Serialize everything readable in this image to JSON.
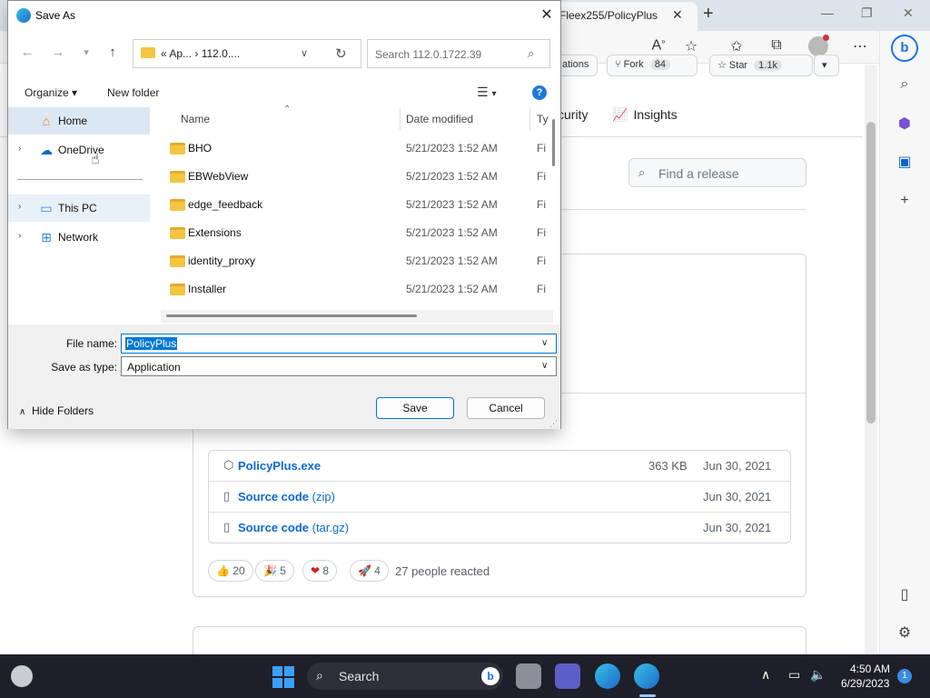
{
  "browser": {
    "active_tab_title": "Fleex255/PolicyPlus",
    "tab_close_glyph": "✕",
    "new_tab_glyph": "+",
    "window_controls": {
      "minimize": "—",
      "restore": "❐",
      "close": "✕"
    },
    "bing_label": "b"
  },
  "github": {
    "notifications_partial": "ations",
    "fork_label": "Fork",
    "fork_count": "84",
    "star_label": "Star",
    "star_count": "1.1k",
    "tab_security": "curity",
    "tab_insights": "Insights",
    "find_release_placeholder": "Find a release",
    "assets": [
      {
        "name": "PolicyPlus.exe",
        "ext": "",
        "size": "363 KB",
        "date": "Jun 30, 2021"
      },
      {
        "name": "Source code",
        "ext": " (zip)",
        "size": "",
        "date": "Jun 30, 2021"
      },
      {
        "name": "Source code",
        "ext": " (tar.gz)",
        "size": "",
        "date": "Jun 30, 2021"
      }
    ],
    "reactions": [
      {
        "emoji": "👍",
        "count": "20"
      },
      {
        "emoji": "🎉",
        "count": "5"
      },
      {
        "emoji": "❤",
        "count": "8"
      },
      {
        "emoji": "🚀",
        "count": "4"
      }
    ],
    "reacted_text": "27 people reacted"
  },
  "dialog": {
    "title": "Save As",
    "close_glyph": "✕",
    "address_crumbs": "«  Ap...  ›  112.0....",
    "search_placeholder": "Search 112.0.1722.39",
    "organize_label": "Organize ▾",
    "new_folder_label": "New folder",
    "help_label": "?",
    "nav_items": [
      {
        "label": "Home",
        "selected": true
      },
      {
        "label": "OneDrive",
        "selected": false
      },
      {
        "label": "This PC",
        "selected": false
      },
      {
        "label": "Network",
        "selected": false
      }
    ],
    "columns": {
      "name": "Name",
      "date": "Date modified",
      "type": "Ty"
    },
    "files": [
      {
        "name": "BHO",
        "date": "5/21/2023 1:52 AM",
        "type": "Fi"
      },
      {
        "name": "EBWebView",
        "date": "5/21/2023 1:52 AM",
        "type": "Fi"
      },
      {
        "name": "edge_feedback",
        "date": "5/21/2023 1:52 AM",
        "type": "Fi"
      },
      {
        "name": "Extensions",
        "date": "5/21/2023 1:52 AM",
        "type": "Fi"
      },
      {
        "name": "identity_proxy",
        "date": "5/21/2023 1:52 AM",
        "type": "Fi"
      },
      {
        "name": "Installer",
        "date": "5/21/2023 1:52 AM",
        "type": "Fi"
      }
    ],
    "file_name_label": "File name:",
    "file_name_value": "PolicyPlus",
    "save_type_label": "Save as type:",
    "save_type_value": "Application",
    "hide_folders_label": "Hide Folders",
    "save_label": "Save",
    "cancel_label": "Cancel"
  },
  "taskbar": {
    "search_label": "Search",
    "time": "4:50 AM",
    "date": "6/29/2023",
    "notification_count": "1"
  },
  "colors": {
    "accent": "#0078d4",
    "link": "#0969da",
    "taskbar_bg": "#1f1f2a",
    "folder": "#f5c542"
  }
}
